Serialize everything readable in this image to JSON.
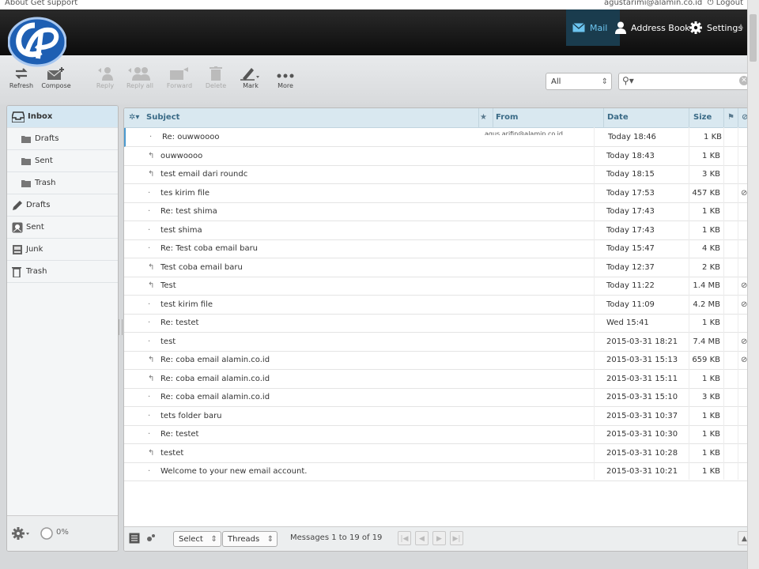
{
  "topbar": {
    "links": "About   Get support",
    "user": "agustarimi@alamin.co.id",
    "logout": "Logout"
  },
  "header": {
    "nav": [
      {
        "label": "Mail"
      },
      {
        "label": "Address Book"
      },
      {
        "label": "Settings"
      }
    ]
  },
  "toolbar": {
    "buttons": [
      {
        "label": "Refresh"
      },
      {
        "label": "Compose"
      },
      {
        "label": "Reply"
      },
      {
        "label": "Reply all"
      },
      {
        "label": "Forward"
      },
      {
        "label": "Delete"
      },
      {
        "label": "Mark"
      },
      {
        "label": "More"
      }
    ],
    "filter": "All",
    "search_placeholder": ""
  },
  "folders": [
    {
      "label": "Inbox"
    },
    {
      "label": "Drafts"
    },
    {
      "label": "Sent"
    },
    {
      "label": "Trash"
    },
    {
      "label": "Drafts"
    },
    {
      "label": "Sent"
    },
    {
      "label": "Junk"
    },
    {
      "label": "Trash"
    }
  ],
  "quota": "0%",
  "list": {
    "headers": {
      "subject": "Subject",
      "from": "From",
      "date": "Date",
      "size": "Size"
    },
    "from_partial": "agus.arifin@alamin.co.id",
    "rows": [
      {
        "subject": "Re: ouwwoooo",
        "date": "Today 18:46",
        "size": "1 KB",
        "replied": false,
        "attach": false
      },
      {
        "subject": "ouwwoooo",
        "date": "Today 18:43",
        "size": "1 KB",
        "replied": true,
        "attach": false
      },
      {
        "subject": "test email dari roundc",
        "date": "Today 18:15",
        "size": "3 KB",
        "replied": true,
        "attach": false
      },
      {
        "subject": "tes kirim file",
        "date": "Today 17:53",
        "size": "457 KB",
        "replied": false,
        "attach": true
      },
      {
        "subject": "Re: test shima",
        "date": "Today 17:43",
        "size": "1 KB",
        "replied": false,
        "attach": false
      },
      {
        "subject": "test shima",
        "date": "Today 17:43",
        "size": "1 KB",
        "replied": false,
        "attach": false
      },
      {
        "subject": "Re: Test coba email baru",
        "date": "Today 15:47",
        "size": "4 KB",
        "replied": false,
        "attach": false
      },
      {
        "subject": "Test coba email baru",
        "date": "Today 12:37",
        "size": "2 KB",
        "replied": true,
        "attach": false
      },
      {
        "subject": "Test",
        "date": "Today 11:22",
        "size": "1.4 MB",
        "replied": true,
        "attach": true
      },
      {
        "subject": "test kirim file",
        "date": "Today 11:09",
        "size": "4.2 MB",
        "replied": false,
        "attach": true
      },
      {
        "subject": "Re: testet",
        "date": "Wed 15:41",
        "size": "1 KB",
        "replied": false,
        "attach": false
      },
      {
        "subject": "test",
        "date": "2015-03-31 18:21",
        "size": "7.4 MB",
        "replied": false,
        "attach": true
      },
      {
        "subject": "Re: coba email alamin.co.id",
        "date": "2015-03-31 15:13",
        "size": "659 KB",
        "replied": true,
        "attach": true
      },
      {
        "subject": "Re: coba email alamin.co.id",
        "date": "2015-03-31 15:11",
        "size": "1 KB",
        "replied": true,
        "attach": false
      },
      {
        "subject": "Re: coba email alamin.co.id",
        "date": "2015-03-31 15:10",
        "size": "3 KB",
        "replied": false,
        "attach": false
      },
      {
        "subject": "tets folder baru",
        "date": "2015-03-31 10:37",
        "size": "1 KB",
        "replied": false,
        "attach": false
      },
      {
        "subject": "Re: testet",
        "date": "2015-03-31 10:30",
        "size": "1 KB",
        "replied": false,
        "attach": false
      },
      {
        "subject": "testet",
        "date": "2015-03-31 10:28",
        "size": "1 KB",
        "replied": true,
        "attach": false
      },
      {
        "subject": "Welcome to your new email account.",
        "date": "2015-03-31 10:21",
        "size": "1 KB",
        "replied": false,
        "attach": false
      }
    ]
  },
  "footer": {
    "select": "Select",
    "threads": "Threads",
    "count": "Messages 1 to 19 of 19"
  }
}
